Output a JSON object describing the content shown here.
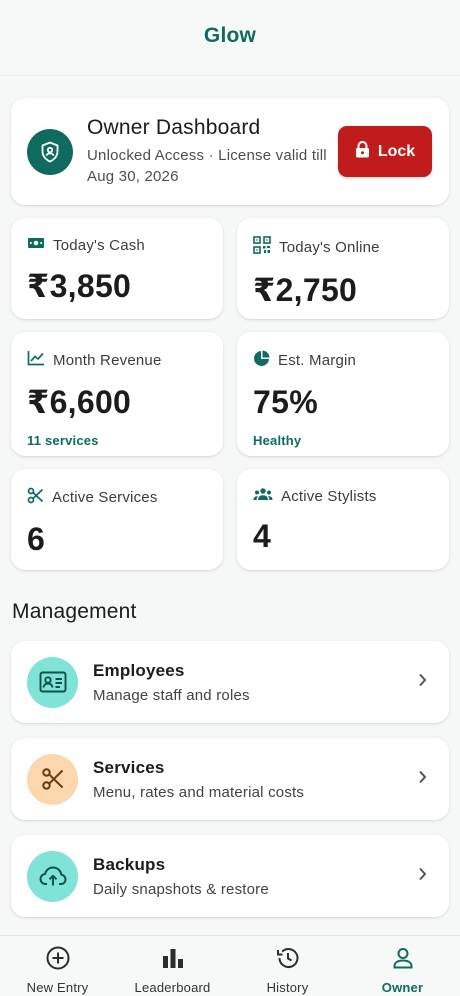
{
  "app": {
    "title": "Glow"
  },
  "owner": {
    "title": "Owner Dashboard",
    "subtitle": "Unlocked Access · License valid till Aug 30, 2026",
    "lock_label": "Lock"
  },
  "stats": {
    "cash": {
      "label": "Today's Cash",
      "value": "₹3,850"
    },
    "online": {
      "label": "Today's Online",
      "value": "₹2,750"
    },
    "revenue": {
      "label": "Month Revenue",
      "value": "₹6,600",
      "foot": "11 services"
    },
    "margin": {
      "label": "Est. Margin",
      "value": "75%",
      "foot": "Healthy"
    },
    "services": {
      "label": "Active Services",
      "value": "6"
    },
    "stylists": {
      "label": "Active Stylists",
      "value": "4"
    }
  },
  "management": {
    "title": "Management",
    "items": [
      {
        "title": "Employees",
        "subtitle": "Manage staff and roles",
        "icon": "id-card-icon",
        "color": "#7fe3d8"
      },
      {
        "title": "Services",
        "subtitle": "Menu, rates and material costs",
        "icon": "scissors-icon",
        "color": "#fcd7ad"
      },
      {
        "title": "Backups",
        "subtitle": "Daily snapshots & restore",
        "icon": "cloud-upload-icon",
        "color": "#7fe3d8"
      }
    ]
  },
  "nav": {
    "items": [
      {
        "label": "New Entry",
        "icon": "plus-circle-icon"
      },
      {
        "label": "Leaderboard",
        "icon": "bar-chart-icon"
      },
      {
        "label": "History",
        "icon": "history-icon"
      },
      {
        "label": "Owner",
        "icon": "person-icon",
        "active": true
      }
    ]
  },
  "colors": {
    "accent": "#0f6b5f",
    "danger": "#c11c1c"
  }
}
